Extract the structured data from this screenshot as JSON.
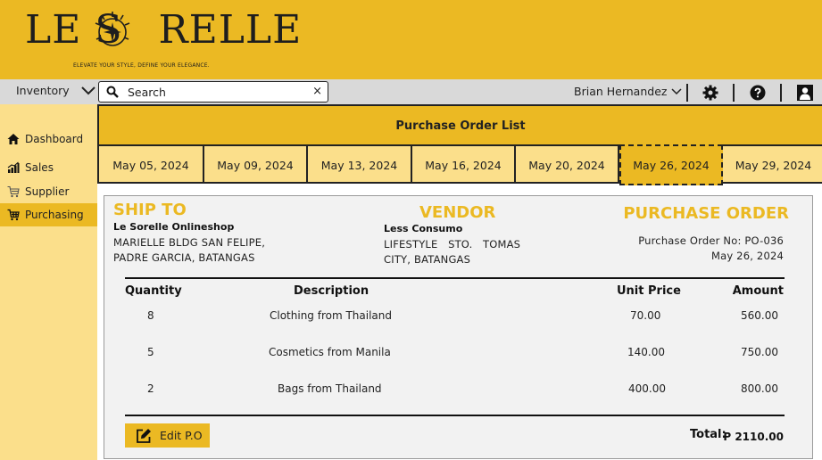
{
  "brand": {
    "logo_text": "LE S  RELLE",
    "tagline": "ELEVATE YOUR STYLE, DEFINE YOUR ELEGANCE."
  },
  "toolbar": {
    "module_label": "Inventory",
    "search": {
      "placeholder": "Search",
      "clear_label": "×"
    },
    "user_name": "Brian Hernandez",
    "icons": [
      "chevron-down-icon",
      "search-icon",
      "close-icon",
      "gear-icon",
      "help-icon",
      "user-icon"
    ]
  },
  "sidebar": {
    "items": [
      {
        "label": "Dashboard",
        "icon": "home-icon"
      },
      {
        "label": "Sales",
        "icon": "bar-chart-icon"
      },
      {
        "label": "Supplier",
        "icon": "cart-icon"
      },
      {
        "label": "Purchasing",
        "icon": "cart-icon"
      }
    ],
    "active": "Purchasing"
  },
  "main": {
    "title": "Purchase Order List",
    "tabs": [
      {
        "label": "May 05, 2024"
      },
      {
        "label": "May 09, 2024"
      },
      {
        "label": "May 13, 2024"
      },
      {
        "label": "May 16, 2024"
      },
      {
        "label": "May 20, 2024"
      },
      {
        "label": "May 26, 2024"
      },
      {
        "label": "May 29, 2024"
      }
    ],
    "active_tab": "May 26, 2024"
  },
  "po": {
    "ship_to": {
      "heading": "SHIP TO",
      "name": "Le Sorelle Onlineshop",
      "line1": "MARIELLE BLDG SAN FELIPE,",
      "line2": "PADRE GARCIA, BATANGAS"
    },
    "vendor": {
      "heading": "VENDOR",
      "name": "Less Consumo",
      "line1": "LIFESTYLE   STO.   TOMAS",
      "line2": "CITY, BATANGAS"
    },
    "order": {
      "heading": "PURCHASE ORDER",
      "number": "Purchase Order No: PO-036",
      "date": "May 26, 2024"
    },
    "columns": {
      "quantity": "Quantity",
      "description": "Description",
      "unit_price": "Unit Price",
      "amount": "Amount"
    },
    "rows": [
      {
        "quantity": "8",
        "description": "Clothing from Thailand",
        "unit_price": "70.00",
        "amount": "560.00"
      },
      {
        "quantity": "5",
        "description": "Cosmetics from Manila",
        "unit_price": "140.00",
        "amount": "750.00"
      },
      {
        "quantity": "2",
        "description": "Bags from Thailand",
        "unit_price": "400.00",
        "amount": "800.00"
      }
    ],
    "edit_label": "Edit P.O",
    "total_label": "Total:",
    "total_value": "P 2110.00"
  },
  "colors": {
    "brand_yellow": "#EBB923",
    "light_yellow": "#FBDF8B",
    "toolbar_grey": "#D9D9D9",
    "panel_grey": "#F2F2F2"
  }
}
